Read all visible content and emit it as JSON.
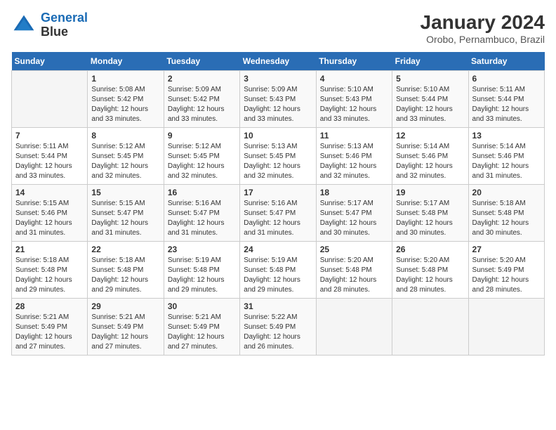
{
  "header": {
    "logo_line1": "General",
    "logo_line2": "Blue",
    "month_title": "January 2024",
    "subtitle": "Orobo, Pernambuco, Brazil"
  },
  "weekdays": [
    "Sunday",
    "Monday",
    "Tuesday",
    "Wednesday",
    "Thursday",
    "Friday",
    "Saturday"
  ],
  "weeks": [
    [
      {
        "day": null
      },
      {
        "day": 1,
        "sunrise": "5:08 AM",
        "sunset": "5:42 PM",
        "daylight": "12 hours and 33 minutes."
      },
      {
        "day": 2,
        "sunrise": "5:09 AM",
        "sunset": "5:42 PM",
        "daylight": "12 hours and 33 minutes."
      },
      {
        "day": 3,
        "sunrise": "5:09 AM",
        "sunset": "5:43 PM",
        "daylight": "12 hours and 33 minutes."
      },
      {
        "day": 4,
        "sunrise": "5:10 AM",
        "sunset": "5:43 PM",
        "daylight": "12 hours and 33 minutes."
      },
      {
        "day": 5,
        "sunrise": "5:10 AM",
        "sunset": "5:44 PM",
        "daylight": "12 hours and 33 minutes."
      },
      {
        "day": 6,
        "sunrise": "5:11 AM",
        "sunset": "5:44 PM",
        "daylight": "12 hours and 33 minutes."
      }
    ],
    [
      {
        "day": 7,
        "sunrise": "5:11 AM",
        "sunset": "5:44 PM",
        "daylight": "12 hours and 33 minutes."
      },
      {
        "day": 8,
        "sunrise": "5:12 AM",
        "sunset": "5:45 PM",
        "daylight": "12 hours and 32 minutes."
      },
      {
        "day": 9,
        "sunrise": "5:12 AM",
        "sunset": "5:45 PM",
        "daylight": "12 hours and 32 minutes."
      },
      {
        "day": 10,
        "sunrise": "5:13 AM",
        "sunset": "5:45 PM",
        "daylight": "12 hours and 32 minutes."
      },
      {
        "day": 11,
        "sunrise": "5:13 AM",
        "sunset": "5:46 PM",
        "daylight": "12 hours and 32 minutes."
      },
      {
        "day": 12,
        "sunrise": "5:14 AM",
        "sunset": "5:46 PM",
        "daylight": "12 hours and 32 minutes."
      },
      {
        "day": 13,
        "sunrise": "5:14 AM",
        "sunset": "5:46 PM",
        "daylight": "12 hours and 31 minutes."
      }
    ],
    [
      {
        "day": 14,
        "sunrise": "5:15 AM",
        "sunset": "5:46 PM",
        "daylight": "12 hours and 31 minutes."
      },
      {
        "day": 15,
        "sunrise": "5:15 AM",
        "sunset": "5:47 PM",
        "daylight": "12 hours and 31 minutes."
      },
      {
        "day": 16,
        "sunrise": "5:16 AM",
        "sunset": "5:47 PM",
        "daylight": "12 hours and 31 minutes."
      },
      {
        "day": 17,
        "sunrise": "5:16 AM",
        "sunset": "5:47 PM",
        "daylight": "12 hours and 31 minutes."
      },
      {
        "day": 18,
        "sunrise": "5:17 AM",
        "sunset": "5:47 PM",
        "daylight": "12 hours and 30 minutes."
      },
      {
        "day": 19,
        "sunrise": "5:17 AM",
        "sunset": "5:48 PM",
        "daylight": "12 hours and 30 minutes."
      },
      {
        "day": 20,
        "sunrise": "5:18 AM",
        "sunset": "5:48 PM",
        "daylight": "12 hours and 30 minutes."
      }
    ],
    [
      {
        "day": 21,
        "sunrise": "5:18 AM",
        "sunset": "5:48 PM",
        "daylight": "12 hours and 29 minutes."
      },
      {
        "day": 22,
        "sunrise": "5:18 AM",
        "sunset": "5:48 PM",
        "daylight": "12 hours and 29 minutes."
      },
      {
        "day": 23,
        "sunrise": "5:19 AM",
        "sunset": "5:48 PM",
        "daylight": "12 hours and 29 minutes."
      },
      {
        "day": 24,
        "sunrise": "5:19 AM",
        "sunset": "5:48 PM",
        "daylight": "12 hours and 29 minutes."
      },
      {
        "day": 25,
        "sunrise": "5:20 AM",
        "sunset": "5:48 PM",
        "daylight": "12 hours and 28 minutes."
      },
      {
        "day": 26,
        "sunrise": "5:20 AM",
        "sunset": "5:48 PM",
        "daylight": "12 hours and 28 minutes."
      },
      {
        "day": 27,
        "sunrise": "5:20 AM",
        "sunset": "5:49 PM",
        "daylight": "12 hours and 28 minutes."
      }
    ],
    [
      {
        "day": 28,
        "sunrise": "5:21 AM",
        "sunset": "5:49 PM",
        "daylight": "12 hours and 27 minutes."
      },
      {
        "day": 29,
        "sunrise": "5:21 AM",
        "sunset": "5:49 PM",
        "daylight": "12 hours and 27 minutes."
      },
      {
        "day": 30,
        "sunrise": "5:21 AM",
        "sunset": "5:49 PM",
        "daylight": "12 hours and 27 minutes."
      },
      {
        "day": 31,
        "sunrise": "5:22 AM",
        "sunset": "5:49 PM",
        "daylight": "12 hours and 26 minutes."
      },
      {
        "day": null
      },
      {
        "day": null
      },
      {
        "day": null
      }
    ]
  ]
}
